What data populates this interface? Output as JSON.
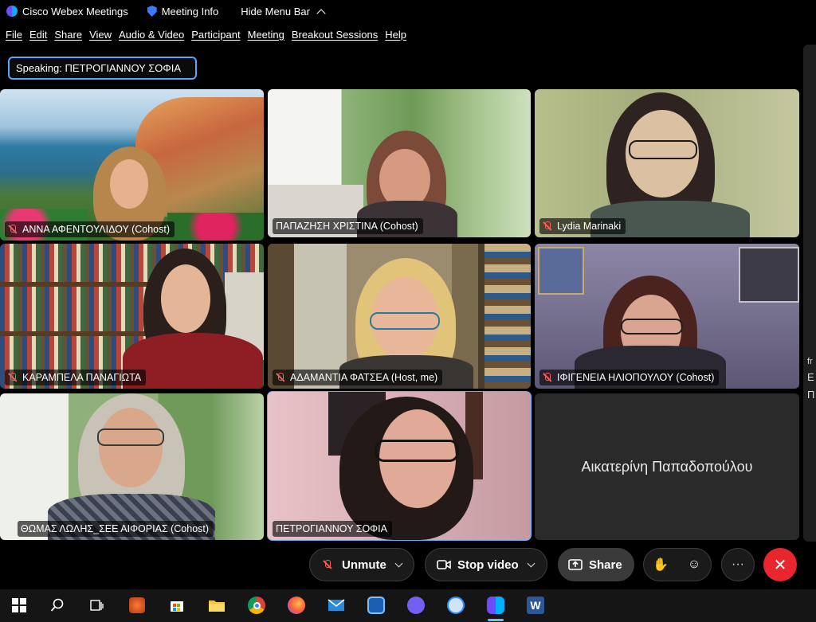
{
  "titlebar": {
    "app_name": "Cisco Webex Meetings",
    "meeting_info": "Meeting Info",
    "hide_menu": "Hide Menu Bar"
  },
  "menu": [
    "File",
    "Edit",
    "Share",
    "View",
    "Audio & Video",
    "Participant",
    "Meeting",
    "Breakout Sessions",
    "Help"
  ],
  "speaking": {
    "label": "Speaking:",
    "name": "ΠΕΤΡΟΓΙΑΝΝΟΥ ΣΟΦΙΑ"
  },
  "participants": [
    {
      "name": "ΑΝΝΑ ΑΦΕΝΤΟΥΛΙΔΟΥ (Cohost)",
      "muted": true
    },
    {
      "name": "ΠΑΠΑΖΗΣΗ ΧΡΙΣΤΙΝΑ (Cohost)",
      "muted": false
    },
    {
      "name": "Lydia Marinaki",
      "muted": true
    },
    {
      "name": "ΚΑΡΑΜΠΕΛΑ ΠΑΝΑΓΙΩΤΑ",
      "muted": true
    },
    {
      "name": "ΑΔΑΜΑΝΤΙΑ ΦΑΤΣΕΑ (Host, me)",
      "muted": true
    },
    {
      "name": "ΙΦΙΓΕΝΕΙΑ ΗΛΙΟΠΟΥΛΟΥ (Cohost)",
      "muted": true
    },
    {
      "name": "ΘΩΜΑΣ ΛΩΛΗΣ_ΣΕΕ ΑΙΦΟΡΙΑΣ (Cohost)",
      "muted": false
    },
    {
      "name": "ΠΕΤΡΟΓΙΑΝΝΟΥ ΣΟΦΙΑ",
      "muted": false,
      "active_speaker": true
    },
    {
      "name": "Αικατερίνη Παπαδοπούλου",
      "muted": false,
      "video": false
    }
  ],
  "side_panel": {
    "fragment_1": "fr",
    "fragment_2": "E",
    "fragment_3": "Π"
  },
  "controls": {
    "unmute": "Unmute",
    "stop_video": "Stop video",
    "share": "Share",
    "more": "···",
    "end": "✕"
  },
  "taskbar": [
    "windows-start",
    "search",
    "task-view",
    "game-app",
    "microsoft-store",
    "file-explorer",
    "chrome",
    "firefox",
    "mail",
    "webex-meetings-launcher",
    "viber",
    "zoom",
    "webex",
    "word"
  ],
  "colors": {
    "accent_blue": "#5aa6ff",
    "mute_red": "#ff5a5a",
    "end_red": "#e8262e"
  }
}
